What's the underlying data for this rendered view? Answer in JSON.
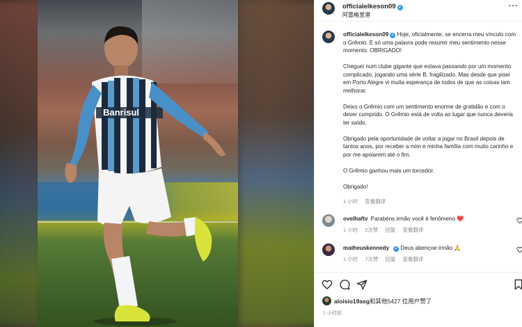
{
  "post_owner": {
    "username": "officialelkeson09",
    "location": "阿雷格里港"
  },
  "caption": {
    "username": "officialelkeson09",
    "paragraphs": [
      "Hoje, oficialmente, se encerra meu vínculo com o Grêmio. E só uma palavra pode resumir meu sentimento nesse momento: OBRIGADO!",
      "Cheguei num clube gigante que estava passando por um momento complicado, jogando uma série B, fragilizado. Mas desde que pisei em Porto Alegre vi muita esperança de todos de que as coisas iam melhorar.",
      "Deixo o Grêmio com um sentimento enorme de gratidão e com o dever cumprido. O Grêmio está de volta ao lugar que nunca deveria ter saído.",
      "Obrigado pela oportunidade de voltar a jogar no Brasil depois de tantos anos, por receber a mim e minha família com muito carinho e por me apoiarem até o fim.",
      "O Grêmio ganhou mais um torcedor.",
      "Obrigado!"
    ],
    "time": "1 小时",
    "see_translation": "查看翻译"
  },
  "comments": [
    {
      "username": "ovelhaftv",
      "text": "Parabéns irmão você é fenômeno",
      "emoji": "❤️",
      "time": "1 小时",
      "likes": "2次赞",
      "reply": "回复",
      "see_translation": "查看翻译"
    },
    {
      "username": "matheuskennedy",
      "text": "Deus abençoe irmão",
      "emoji": "🙏",
      "time": "1 小时",
      "likes": "7次赞",
      "reply": "回复",
      "see_translation": "查看翻译"
    }
  ],
  "likes_line": {
    "username": "aloisio19asg",
    "rest": "和其他5427 位用户赞了"
  },
  "post_time": "1 小时前",
  "photo_text": {
    "sponsor": "Banrisul"
  },
  "icons": {
    "more": "more-options-icon",
    "like": "heart-icon",
    "comment": "comment-icon",
    "share": "share-icon",
    "save": "bookmark-icon",
    "comment_like": "heart-outline-icon"
  },
  "colors": {
    "verified": "#3897f0",
    "heart_emoji": "#e0245e",
    "text": "#262626",
    "muted": "#8e8e8e"
  }
}
